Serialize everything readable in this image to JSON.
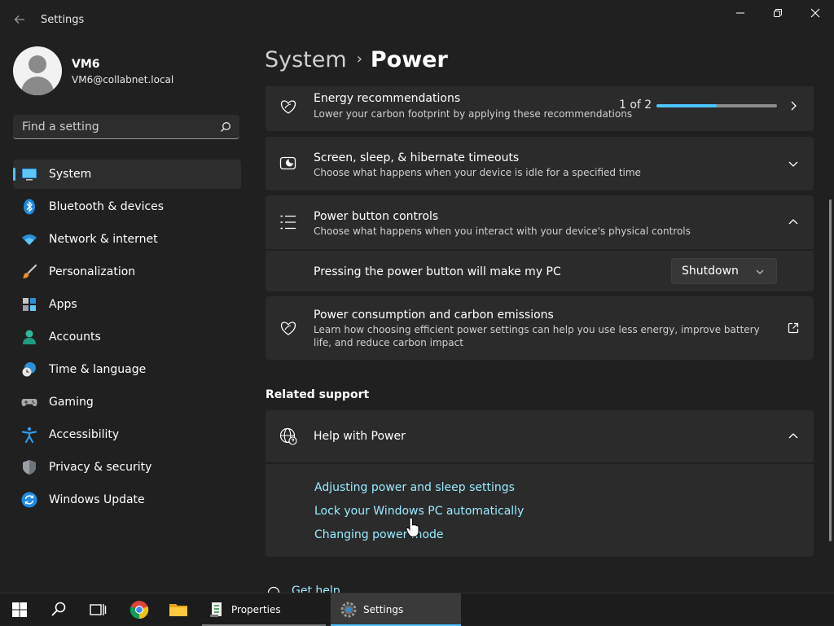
{
  "window": {
    "title": "Settings",
    "controls": [
      "minimize",
      "maximize",
      "close"
    ]
  },
  "user": {
    "name": "VM6",
    "email": "VM6@collabnet.local"
  },
  "search": {
    "placeholder": "Find a setting",
    "icon": "search-icon"
  },
  "sidebar": {
    "items": [
      {
        "label": "System",
        "icon": "system-icon",
        "active": true
      },
      {
        "label": "Bluetooth & devices",
        "icon": "bluetooth-icon"
      },
      {
        "label": "Network & internet",
        "icon": "wifi-icon"
      },
      {
        "label": "Personalization",
        "icon": "brush-icon"
      },
      {
        "label": "Apps",
        "icon": "apps-icon"
      },
      {
        "label": "Accounts",
        "icon": "accounts-icon"
      },
      {
        "label": "Time & language",
        "icon": "time-language-icon"
      },
      {
        "label": "Gaming",
        "icon": "gamepad-icon"
      },
      {
        "label": "Accessibility",
        "icon": "accessibility-icon"
      },
      {
        "label": "Privacy & security",
        "icon": "shield-icon"
      },
      {
        "label": "Windows Update",
        "icon": "update-icon"
      }
    ]
  },
  "breadcrumb": {
    "parent": "System",
    "separator": "›",
    "current": "Power"
  },
  "cards": {
    "energy": {
      "title": "Energy recommendations",
      "description": "Lower your carbon footprint by applying these recommendations",
      "progress_label": "1 of 2",
      "progress_fraction": 0.5
    },
    "screen_sleep": {
      "title": "Screen, sleep, & hibernate timeouts",
      "description": "Choose what happens when your device is idle for a specified time"
    },
    "power_button": {
      "title": "Power button controls",
      "description": "Choose what happens when you interact with your device's physical controls",
      "setting_label": "Pressing the power button will make my PC",
      "selected_value": "Shutdown"
    },
    "consumption": {
      "title": "Power consumption and carbon emissions",
      "description": "Learn how choosing efficient power settings can help you use less energy, improve battery life, and reduce carbon impact"
    }
  },
  "related": {
    "heading": "Related support",
    "help": {
      "title": "Help with Power",
      "links": [
        "Adjusting power and sleep settings",
        "Lock your Windows PC automatically",
        "Changing power mode"
      ]
    },
    "get_help": "Get help"
  },
  "taskbar": {
    "apps": [
      {
        "label": "Properties",
        "icon": "properties-icon",
        "state": "running"
      },
      {
        "label": "Settings",
        "icon": "settings-gear-icon",
        "state": "active"
      }
    ],
    "pinned": [
      "windows-start-icon",
      "search-icon",
      "task-view-icon",
      "chrome-icon",
      "file-explorer-icon"
    ]
  },
  "colors": {
    "accent": "#4cc2ff",
    "link": "#99ebff",
    "card_bg": "#2b2b2b",
    "window_bg": "#202020"
  }
}
